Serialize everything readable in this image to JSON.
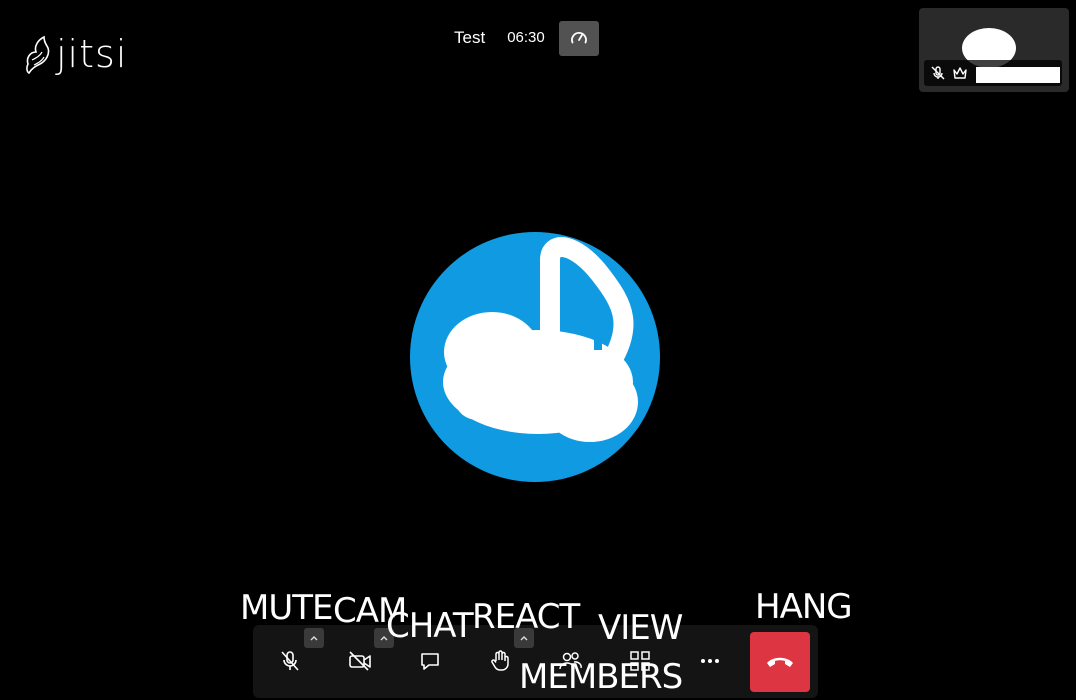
{
  "app": {
    "logo_text": "jitsi"
  },
  "meeting": {
    "title": "Test",
    "timer": "06:30"
  },
  "icons": {
    "stats": "speedometer-icon",
    "mic": "microphone-off-icon",
    "camera": "camera-off-icon",
    "chat": "chat-icon",
    "raise_hand": "hand-icon",
    "participants": "people-icon",
    "tile_view": "grid-icon",
    "more": "more-icon",
    "hangup": "phone-hangup-icon",
    "moderator": "crown-icon"
  },
  "colors": {
    "avatar_bg": "#0f9ae1",
    "hangup_bg": "#dd3542",
    "toolbar_bg": "#141414"
  },
  "overlay_labels": {
    "mute": "MUTE",
    "cam": "CAM",
    "chat": "CHAT",
    "react": "REACT",
    "view": "VIEW",
    "members": "MEMBERS",
    "hang": "HANG"
  }
}
